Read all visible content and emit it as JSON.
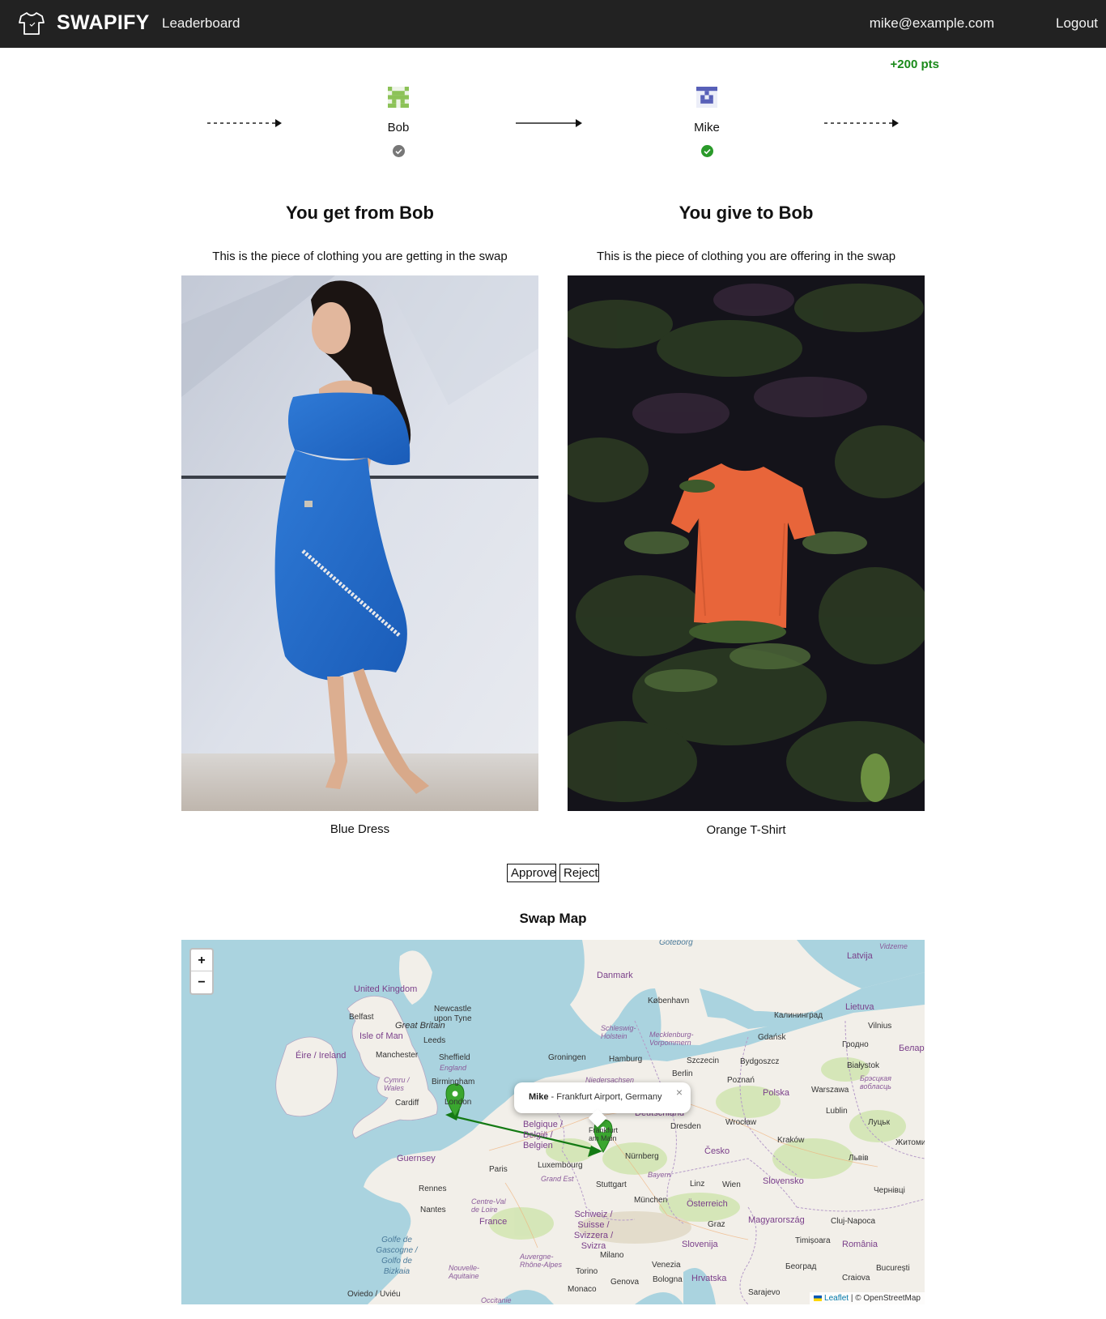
{
  "nav": {
    "brand": "SWAPIFY",
    "leaderboard": "Leaderboard",
    "email": "mike@example.com",
    "logout": "Logout"
  },
  "points": "+200 pts",
  "chain": {
    "left_user": "Bob",
    "right_user": "Mike"
  },
  "get": {
    "title": "You get from Bob",
    "description": "This is the piece of clothing you are getting in the swap",
    "item": "Blue Dress"
  },
  "give": {
    "title": "You give to Bob",
    "description": "This is the piece of clothing you are offering in the swap",
    "item": "Orange T-Shirt"
  },
  "actions": {
    "approve": "Approve",
    "reject": "Reject"
  },
  "map": {
    "title": "Swap Map",
    "zoom_in": "+",
    "zoom_out": "−",
    "popup_name": "Mike",
    "popup_location": " - Frankfurt Airport, Germany",
    "popup_close": "×",
    "attribution_leaflet": "Leaflet",
    "attribution_osm": "© OpenStreetMap",
    "labels": {
      "uk": "United Kingdom",
      "great_britain": "Great Britain",
      "ireland": "Éire / Ireland",
      "isle_of_man": "Isle of Man",
      "belfast": "Belfast",
      "newcastle": "Newcastle upon Tyne",
      "leeds": "Leeds",
      "manchester": "Manchester",
      "sheffield": "Sheffield",
      "england": "England",
      "birmingham": "Birmingham",
      "wales": "Cymru / Wales",
      "cardiff": "Cardiff",
      "london": "London",
      "guernsey": "Guernsey",
      "rennes": "Rennes",
      "nantes": "Nantes",
      "paris": "Paris",
      "centre": "Centre-Val de Loire",
      "france": "France",
      "biscay": "Golfe de Gascogne / Golfo de Bizkaia",
      "aquitaine": "Nouvelle-Aquitaine",
      "auvergne": "Auvergne-Rhône-Alpes",
      "occitanie": "Occitanie",
      "oviedo": "Oviedo / Uviéu",
      "danmark": "Danmark",
      "kobenhavn": "København",
      "schleswig": "Schleswig-Holstein",
      "mecklenburg": "Mecklenburg-Vorpommern",
      "hamburg": "Hamburg",
      "groningen": "Groningen",
      "niedersachsen": "Niedersachsen",
      "berlin": "Berlin",
      "szczecin": "Szczecin",
      "belgique": "Belgique / België / Belgien",
      "luxembourg": "Luxembourg",
      "grand_est": "Grand Est",
      "frankfurt": "Frankfurt am Main",
      "deutschland": "Deutschland",
      "dresden": "Dresden",
      "nurnberg": "Nürnberg",
      "bayern": "Bayern",
      "stuttgart": "Stuttgart",
      "munchen": "München",
      "schweiz": "Schweiz / Suisse / Svizzera / Svizra",
      "milano": "Milano",
      "torino": "Torino",
      "genova": "Genova",
      "bologna": "Bologna",
      "venezia": "Venezia",
      "monaco": "Monaco",
      "linz": "Linz",
      "wien": "Wien",
      "osterreich": "Österreich",
      "graz": "Graz",
      "cesko": "Česko",
      "wroclaw": "Wrocław",
      "poznan": "Poznań",
      "polska": "Polska",
      "bydgoszcz": "Bydgoszcz",
      "gdansk": "Gdańsk",
      "kaliningrad": "Калининград",
      "warszawa": "Warszawa",
      "lublin": "Lublin",
      "krakow": "Kraków",
      "slovensko": "Slovensko",
      "magyarorszag": "Magyarország",
      "slovenija": "Slovenija",
      "hrvatska": "Hrvatska",
      "sarajevo": "Sarajevo",
      "beograd": "Београд",
      "timisoara": "Timișoara",
      "cluj": "Cluj-Napoca",
      "romania": "România",
      "craiova": "Craiova",
      "bucuresti": "București",
      "latvija": "Latvija",
      "lietuva": "Lietuva",
      "vilnius": "Vilnius",
      "grodno": "Гродно",
      "bialystok": "Białystok",
      "brest": "Брэсцкая вобласць",
      "lutsk": "Луцьк",
      "lviv": "Львів",
      "chernivtsi": "Чернівці",
      "zhytomyr": "Житоми",
      "belar": "Белар",
      "vidzeme": "Vidzeme",
      "goteborg": "Göteborg"
    }
  },
  "colors": {
    "nav_bg": "#222222",
    "points": "#1a8a1a",
    "status_done": "#2a9a2a",
    "status_pending": "#777777",
    "marker": "#3aa62f",
    "route": "#147a14"
  }
}
